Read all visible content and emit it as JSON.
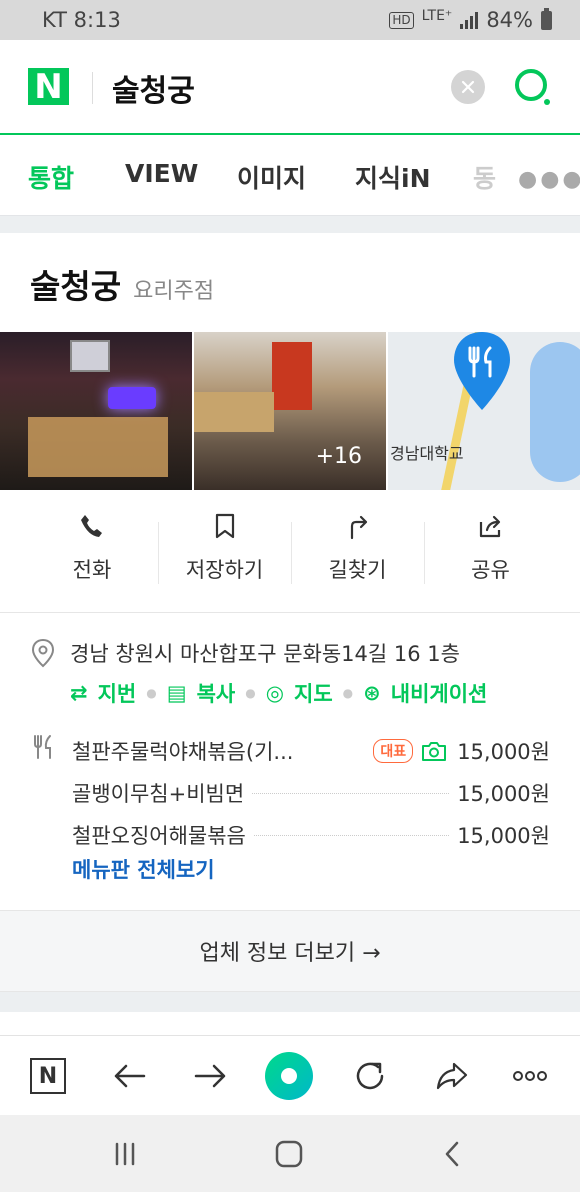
{
  "status_bar": {
    "carrier_time": "KT 8:13",
    "hd": "HD",
    "network": "LTE⁺",
    "battery": "84%"
  },
  "search": {
    "logo": "N",
    "query": "술청궁"
  },
  "tabs": [
    {
      "label": "통합"
    },
    {
      "label": "VIEW"
    },
    {
      "label": "이미지"
    },
    {
      "label": "지식iN"
    },
    {
      "label": "동"
    }
  ],
  "place": {
    "name": "술청궁",
    "category": "요리주점",
    "photo_count": "+16",
    "map_label": "경남대학교"
  },
  "actions": [
    {
      "label": "전화",
      "icon": "phone-icon"
    },
    {
      "label": "저장하기",
      "icon": "bookmark-icon"
    },
    {
      "label": "길찾기",
      "icon": "directions-icon"
    },
    {
      "label": "공유",
      "icon": "share-icon"
    }
  ],
  "address": {
    "text": "경남 창원시 마산합포구 문화동14길 16 1층",
    "links": [
      "지번",
      "복사",
      "지도",
      "내비게이션"
    ]
  },
  "menu": {
    "items": [
      {
        "name": "철판주물럭야채볶음(기...",
        "badge": "대표",
        "price": "15,000원"
      },
      {
        "name": "골뱅이무침+비빔면",
        "price": "15,000원"
      },
      {
        "name": "철판오징어해물볶음",
        "price": "15,000원"
      }
    ],
    "view_all": "메뉴판 전체보기"
  },
  "more_info": "업체 정보 더보기 →",
  "browser_bar": {
    "home_logo": "N"
  },
  "colors": {
    "brand": "#03c75a",
    "link_blue": "#1565c0",
    "badge_orange": "#ff6a3d"
  }
}
